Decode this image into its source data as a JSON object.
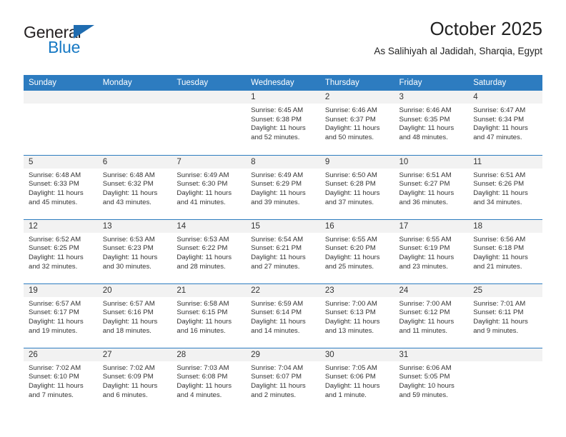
{
  "brand": {
    "name_top": "General",
    "name_bottom": "Blue",
    "accent_color": "#1779c4",
    "triangle_color": "#1f6cb0"
  },
  "header": {
    "title": "October 2025",
    "subtitle": "As Salihiyah al Jadidah, Sharqia, Egypt"
  },
  "theme": {
    "header_row_bg": "#2d7cc0",
    "daynum_band_bg": "#f2f2f2",
    "grid_line": "#2d7cc0",
    "text": "#333333"
  },
  "weekday_headers": [
    "Sunday",
    "Monday",
    "Tuesday",
    "Wednesday",
    "Thursday",
    "Friday",
    "Saturday"
  ],
  "weeks": [
    [
      {
        "day": "",
        "sunrise": "",
        "sunset": "",
        "daylight_line1": "",
        "daylight_line2": "",
        "empty": true
      },
      {
        "day": "",
        "sunrise": "",
        "sunset": "",
        "daylight_line1": "",
        "daylight_line2": "",
        "empty": true
      },
      {
        "day": "",
        "sunrise": "",
        "sunset": "",
        "daylight_line1": "",
        "daylight_line2": "",
        "empty": true
      },
      {
        "day": "1",
        "sunrise": "Sunrise: 6:45 AM",
        "sunset": "Sunset: 6:38 PM",
        "daylight_line1": "Daylight: 11 hours",
        "daylight_line2": "and 52 minutes."
      },
      {
        "day": "2",
        "sunrise": "Sunrise: 6:46 AM",
        "sunset": "Sunset: 6:37 PM",
        "daylight_line1": "Daylight: 11 hours",
        "daylight_line2": "and 50 minutes."
      },
      {
        "day": "3",
        "sunrise": "Sunrise: 6:46 AM",
        "sunset": "Sunset: 6:35 PM",
        "daylight_line1": "Daylight: 11 hours",
        "daylight_line2": "and 48 minutes."
      },
      {
        "day": "4",
        "sunrise": "Sunrise: 6:47 AM",
        "sunset": "Sunset: 6:34 PM",
        "daylight_line1": "Daylight: 11 hours",
        "daylight_line2": "and 47 minutes."
      }
    ],
    [
      {
        "day": "5",
        "sunrise": "Sunrise: 6:48 AM",
        "sunset": "Sunset: 6:33 PM",
        "daylight_line1": "Daylight: 11 hours",
        "daylight_line2": "and 45 minutes."
      },
      {
        "day": "6",
        "sunrise": "Sunrise: 6:48 AM",
        "sunset": "Sunset: 6:32 PM",
        "daylight_line1": "Daylight: 11 hours",
        "daylight_line2": "and 43 minutes."
      },
      {
        "day": "7",
        "sunrise": "Sunrise: 6:49 AM",
        "sunset": "Sunset: 6:30 PM",
        "daylight_line1": "Daylight: 11 hours",
        "daylight_line2": "and 41 minutes."
      },
      {
        "day": "8",
        "sunrise": "Sunrise: 6:49 AM",
        "sunset": "Sunset: 6:29 PM",
        "daylight_line1": "Daylight: 11 hours",
        "daylight_line2": "and 39 minutes."
      },
      {
        "day": "9",
        "sunrise": "Sunrise: 6:50 AM",
        "sunset": "Sunset: 6:28 PM",
        "daylight_line1": "Daylight: 11 hours",
        "daylight_line2": "and 37 minutes."
      },
      {
        "day": "10",
        "sunrise": "Sunrise: 6:51 AM",
        "sunset": "Sunset: 6:27 PM",
        "daylight_line1": "Daylight: 11 hours",
        "daylight_line2": "and 36 minutes."
      },
      {
        "day": "11",
        "sunrise": "Sunrise: 6:51 AM",
        "sunset": "Sunset: 6:26 PM",
        "daylight_line1": "Daylight: 11 hours",
        "daylight_line2": "and 34 minutes."
      }
    ],
    [
      {
        "day": "12",
        "sunrise": "Sunrise: 6:52 AM",
        "sunset": "Sunset: 6:25 PM",
        "daylight_line1": "Daylight: 11 hours",
        "daylight_line2": "and 32 minutes."
      },
      {
        "day": "13",
        "sunrise": "Sunrise: 6:53 AM",
        "sunset": "Sunset: 6:23 PM",
        "daylight_line1": "Daylight: 11 hours",
        "daylight_line2": "and 30 minutes."
      },
      {
        "day": "14",
        "sunrise": "Sunrise: 6:53 AM",
        "sunset": "Sunset: 6:22 PM",
        "daylight_line1": "Daylight: 11 hours",
        "daylight_line2": "and 28 minutes."
      },
      {
        "day": "15",
        "sunrise": "Sunrise: 6:54 AM",
        "sunset": "Sunset: 6:21 PM",
        "daylight_line1": "Daylight: 11 hours",
        "daylight_line2": "and 27 minutes."
      },
      {
        "day": "16",
        "sunrise": "Sunrise: 6:55 AM",
        "sunset": "Sunset: 6:20 PM",
        "daylight_line1": "Daylight: 11 hours",
        "daylight_line2": "and 25 minutes."
      },
      {
        "day": "17",
        "sunrise": "Sunrise: 6:55 AM",
        "sunset": "Sunset: 6:19 PM",
        "daylight_line1": "Daylight: 11 hours",
        "daylight_line2": "and 23 minutes."
      },
      {
        "day": "18",
        "sunrise": "Sunrise: 6:56 AM",
        "sunset": "Sunset: 6:18 PM",
        "daylight_line1": "Daylight: 11 hours",
        "daylight_line2": "and 21 minutes."
      }
    ],
    [
      {
        "day": "19",
        "sunrise": "Sunrise: 6:57 AM",
        "sunset": "Sunset: 6:17 PM",
        "daylight_line1": "Daylight: 11 hours",
        "daylight_line2": "and 19 minutes."
      },
      {
        "day": "20",
        "sunrise": "Sunrise: 6:57 AM",
        "sunset": "Sunset: 6:16 PM",
        "daylight_line1": "Daylight: 11 hours",
        "daylight_line2": "and 18 minutes."
      },
      {
        "day": "21",
        "sunrise": "Sunrise: 6:58 AM",
        "sunset": "Sunset: 6:15 PM",
        "daylight_line1": "Daylight: 11 hours",
        "daylight_line2": "and 16 minutes."
      },
      {
        "day": "22",
        "sunrise": "Sunrise: 6:59 AM",
        "sunset": "Sunset: 6:14 PM",
        "daylight_line1": "Daylight: 11 hours",
        "daylight_line2": "and 14 minutes."
      },
      {
        "day": "23",
        "sunrise": "Sunrise: 7:00 AM",
        "sunset": "Sunset: 6:13 PM",
        "daylight_line1": "Daylight: 11 hours",
        "daylight_line2": "and 13 minutes."
      },
      {
        "day": "24",
        "sunrise": "Sunrise: 7:00 AM",
        "sunset": "Sunset: 6:12 PM",
        "daylight_line1": "Daylight: 11 hours",
        "daylight_line2": "and 11 minutes."
      },
      {
        "day": "25",
        "sunrise": "Sunrise: 7:01 AM",
        "sunset": "Sunset: 6:11 PM",
        "daylight_line1": "Daylight: 11 hours",
        "daylight_line2": "and 9 minutes."
      }
    ],
    [
      {
        "day": "26",
        "sunrise": "Sunrise: 7:02 AM",
        "sunset": "Sunset: 6:10 PM",
        "daylight_line1": "Daylight: 11 hours",
        "daylight_line2": "and 7 minutes."
      },
      {
        "day": "27",
        "sunrise": "Sunrise: 7:02 AM",
        "sunset": "Sunset: 6:09 PM",
        "daylight_line1": "Daylight: 11 hours",
        "daylight_line2": "and 6 minutes."
      },
      {
        "day": "28",
        "sunrise": "Sunrise: 7:03 AM",
        "sunset": "Sunset: 6:08 PM",
        "daylight_line1": "Daylight: 11 hours",
        "daylight_line2": "and 4 minutes."
      },
      {
        "day": "29",
        "sunrise": "Sunrise: 7:04 AM",
        "sunset": "Sunset: 6:07 PM",
        "daylight_line1": "Daylight: 11 hours",
        "daylight_line2": "and 2 minutes."
      },
      {
        "day": "30",
        "sunrise": "Sunrise: 7:05 AM",
        "sunset": "Sunset: 6:06 PM",
        "daylight_line1": "Daylight: 11 hours",
        "daylight_line2": "and 1 minute."
      },
      {
        "day": "31",
        "sunrise": "Sunrise: 6:06 AM",
        "sunset": "Sunset: 5:05 PM",
        "daylight_line1": "Daylight: 10 hours",
        "daylight_line2": "and 59 minutes."
      },
      {
        "day": "",
        "sunrise": "",
        "sunset": "",
        "daylight_line1": "",
        "daylight_line2": "",
        "empty": true
      }
    ]
  ]
}
